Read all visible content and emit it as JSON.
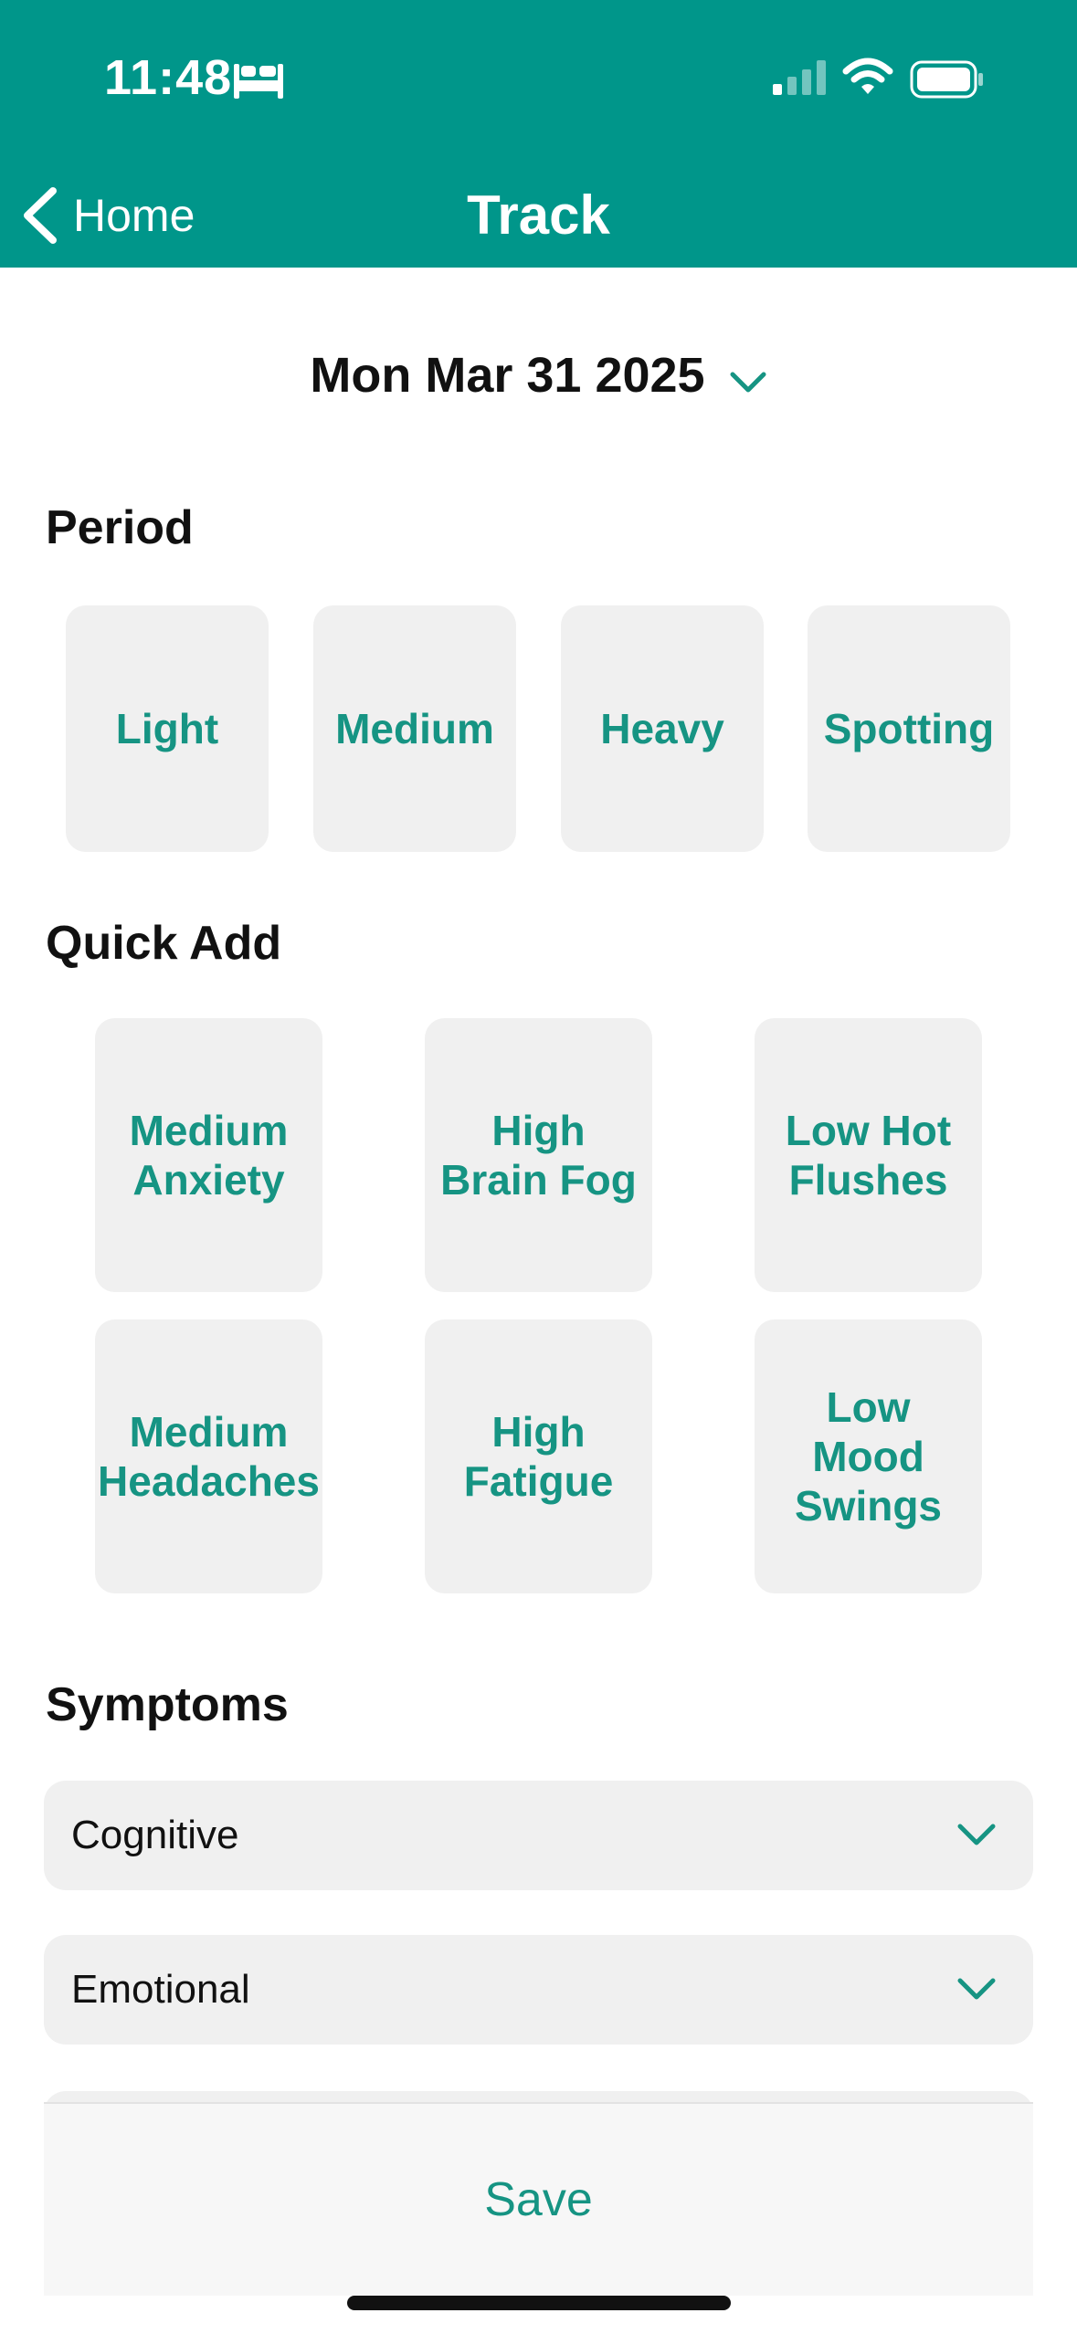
{
  "status_bar": {
    "time": "11:48",
    "icons": [
      "bed-icon",
      "signal-icon",
      "wifi-icon",
      "battery-icon"
    ]
  },
  "nav": {
    "back_label": "Home",
    "title": "Track"
  },
  "date": {
    "value": "Mon Mar 31 2025"
  },
  "period": {
    "title": "Period",
    "options": [
      "Light",
      "Medium",
      "Heavy",
      "Spotting"
    ]
  },
  "quick_add": {
    "title": "Quick Add",
    "items": [
      "Medium Anxiety",
      "High Brain Fog",
      "Low Hot Flushes",
      "Medium Headaches",
      "High Fatigue",
      "Low Mood Swings"
    ]
  },
  "symptoms": {
    "title": "Symptoms",
    "categories": [
      "Cognitive",
      "Emotional"
    ]
  },
  "footer": {
    "save_label": "Save"
  },
  "colors": {
    "header_bg": "#00968A",
    "accent_text": "#169483",
    "tile_bg": "#F0F0F0"
  }
}
